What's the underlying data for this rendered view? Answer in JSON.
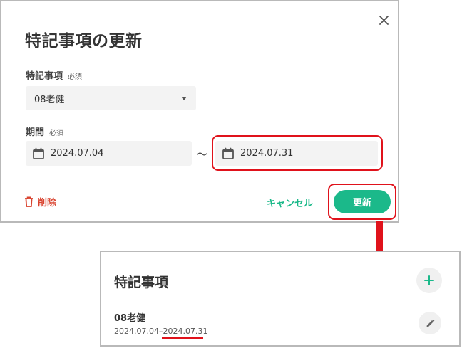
{
  "dialog": {
    "title": "特記事項の更新",
    "close_icon": "close-icon",
    "notes_field": {
      "label": "特記事項",
      "required": "必須",
      "value": "08老健"
    },
    "period_field": {
      "label": "期間",
      "required": "必須",
      "start": "2024.07.04",
      "separator": "〜",
      "end": "2024.07.31"
    },
    "delete_label": "削除",
    "cancel_label": "キャンセル",
    "update_label": "更新"
  },
  "card": {
    "title": "特記事項",
    "item": {
      "title": "08老健",
      "date_start": "2024.07.04",
      "date_sep": "–",
      "date_end": "2024.07.31"
    }
  },
  "colors": {
    "accent": "#1bb98a",
    "danger": "#d9432f",
    "annotation": "#e0121b"
  }
}
